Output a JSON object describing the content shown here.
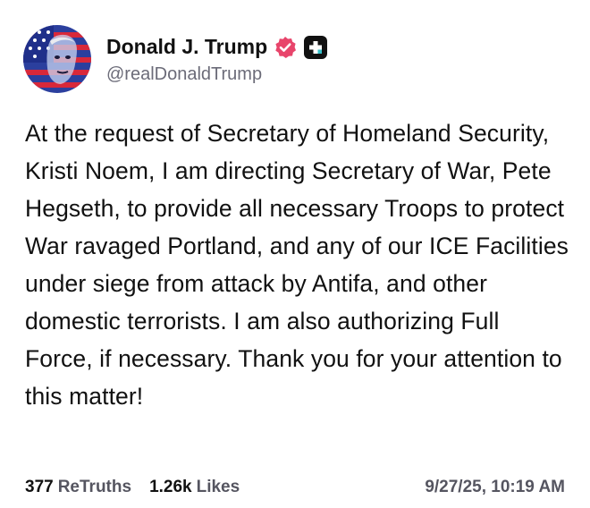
{
  "author": {
    "display_name": "Donald J. Trump",
    "handle": "@realDonaldTrump",
    "avatar_icon": "flag-portrait-avatar",
    "verified_icon": "verified-badge-icon",
    "verified_color": "#e8456b",
    "platform_icon": "truth-social-icon"
  },
  "post": {
    "text": "At the request of Secretary of Homeland Security, Kristi Noem, I am directing Secretary of War, Pete Hegseth, to provide all necessary Troops to protect War ravaged Portland, and any of our ICE Facilities under siege from attack by Antifa, and other domestic terrorists. I am also authorizing Full Force, if necessary. Thank you for your attention to this matter!"
  },
  "stats": {
    "retruths_count": "377",
    "retruths_label": "ReTruths",
    "likes_count": "1.26k",
    "likes_label": "Likes",
    "timestamp": "9/27/25, 10:19 AM"
  }
}
